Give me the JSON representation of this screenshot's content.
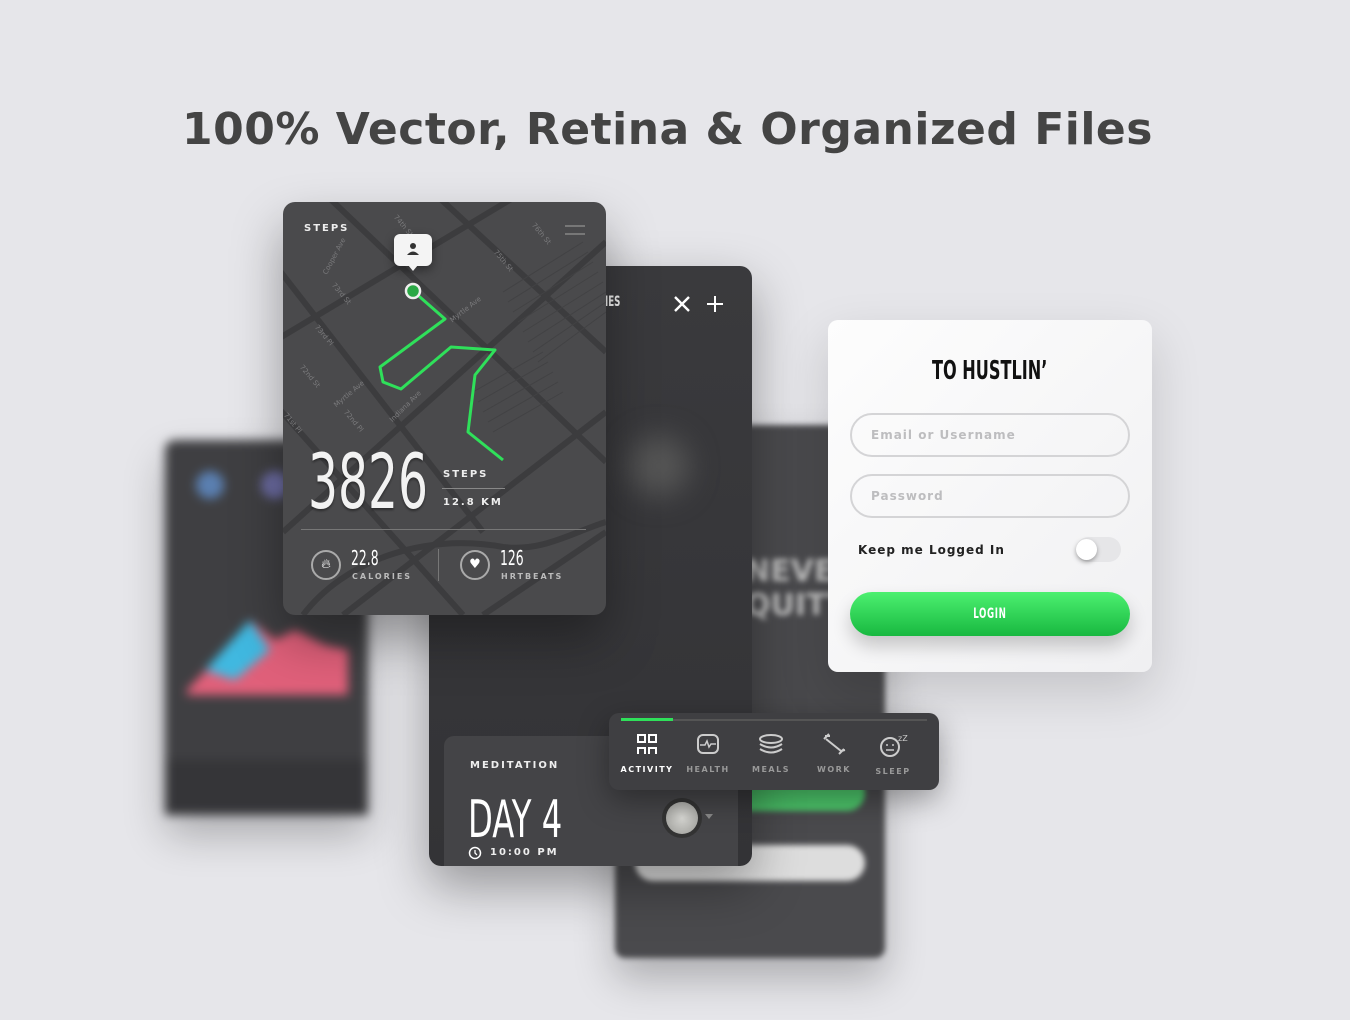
{
  "headline": "100% Vector, Retina & Organized Files",
  "steps_card": {
    "title": "STEPS",
    "steps_value": "3826",
    "steps_label": "STEPS",
    "distance": "12.8 KM",
    "calories_value": "22.8",
    "calories_label": "CALORIES",
    "heartbeats_value": "126",
    "heartbeats_label": "HRTBEATS",
    "route_color": "#2fe05a",
    "street_labels": [
      "74th St",
      "75th St",
      "76th St",
      "Myrtle Ave",
      "Cooper Ave",
      "73rd St",
      "73rd Pl",
      "72nd St",
      "72nd Pl",
      "Myrtle Ave",
      "Indiana Ave",
      "71st Pl"
    ]
  },
  "middle_card": {
    "title_fragment": "IES",
    "tools_icon": "wrench-cross-icon",
    "add_icon": "plus-icon"
  },
  "meditation": {
    "label": "MEDITATION",
    "day": "DAY 4",
    "time": "10:00 PM"
  },
  "nav": {
    "items": [
      {
        "label": "ACTIVITY",
        "icon": "activity-icon",
        "active": true
      },
      {
        "label": "HEALTH",
        "icon": "health-icon"
      },
      {
        "label": "MEALS",
        "icon": "meals-icon"
      },
      {
        "label": "WORK",
        "icon": "dumbbell-icon"
      },
      {
        "label": "SLEEP",
        "icon": "sleep-icon"
      }
    ],
    "progress": 0.17,
    "accent": "#2fe05a"
  },
  "login": {
    "title": "TO HUSTLIN’",
    "email_placeholder": "Email or Username",
    "password_placeholder": "Password",
    "keep_logged_label": "Keep me Logged In",
    "keep_logged_on": false,
    "button": "LOGIN",
    "button_color": "#22c84a"
  },
  "blurred_card": {
    "text": "NEVER QUITTE"
  }
}
